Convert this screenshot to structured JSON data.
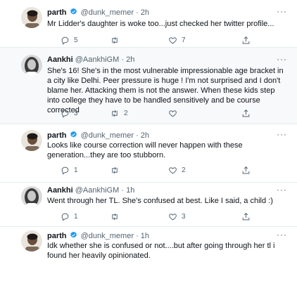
{
  "tweets": [
    {
      "name": "parth",
      "verified": true,
      "handle": "@dunk_memer",
      "dot": "·",
      "time": "2h",
      "more": "···",
      "text": "Mr Lidder's daughter is woke too...just checked her twitter profile...",
      "replies": "5",
      "retweets": "",
      "likes": "7",
      "avatar": "man-avatar"
    },
    {
      "name": "Aankhi",
      "verified": false,
      "handle": "@AankhiGM",
      "dot": "·",
      "time": "2h",
      "more": "···",
      "text": "She's 16! She's in the most vulnerable impressionable age bracket in a city like Delhi. Peer pressure is huge ! I'm not surprised and I don't blame her. Attacking them is not the answer. When these kids step into college they have to be handled sensitively and be course corrected",
      "replies": "3",
      "retweets": "2",
      "likes": "",
      "avatar": "woman-avatar"
    },
    {
      "name": "parth",
      "verified": true,
      "handle": "@dunk_memer",
      "dot": "·",
      "time": "2h",
      "more": "···",
      "text": "Looks like course correction will never happen with these generation...they are too stubborn.",
      "replies": "1",
      "retweets": "",
      "likes": "2",
      "avatar": "man-avatar"
    },
    {
      "name": "Aankhi",
      "verified": false,
      "handle": "@AankhiGM",
      "dot": "·",
      "time": "1h",
      "more": "···",
      "text": "Went through her TL. She's confused at best. Like I said, a child :)",
      "replies": "1",
      "retweets": "",
      "likes": "3",
      "avatar": "woman-avatar"
    },
    {
      "name": "parth",
      "verified": true,
      "handle": "@dunk_memer",
      "dot": "·",
      "time": "1h",
      "more": "···",
      "text": "Idk whether she is confused or not....but after going through her tl i found her heavily opinionated.",
      "replies": "",
      "retweets": "",
      "likes": "",
      "avatar": "man-avatar"
    }
  ],
  "colors": {
    "verified": "#1d9bf0",
    "muted": "#536471",
    "border": "#e6ecf0",
    "highlight_bg": "#f7f9fa"
  }
}
